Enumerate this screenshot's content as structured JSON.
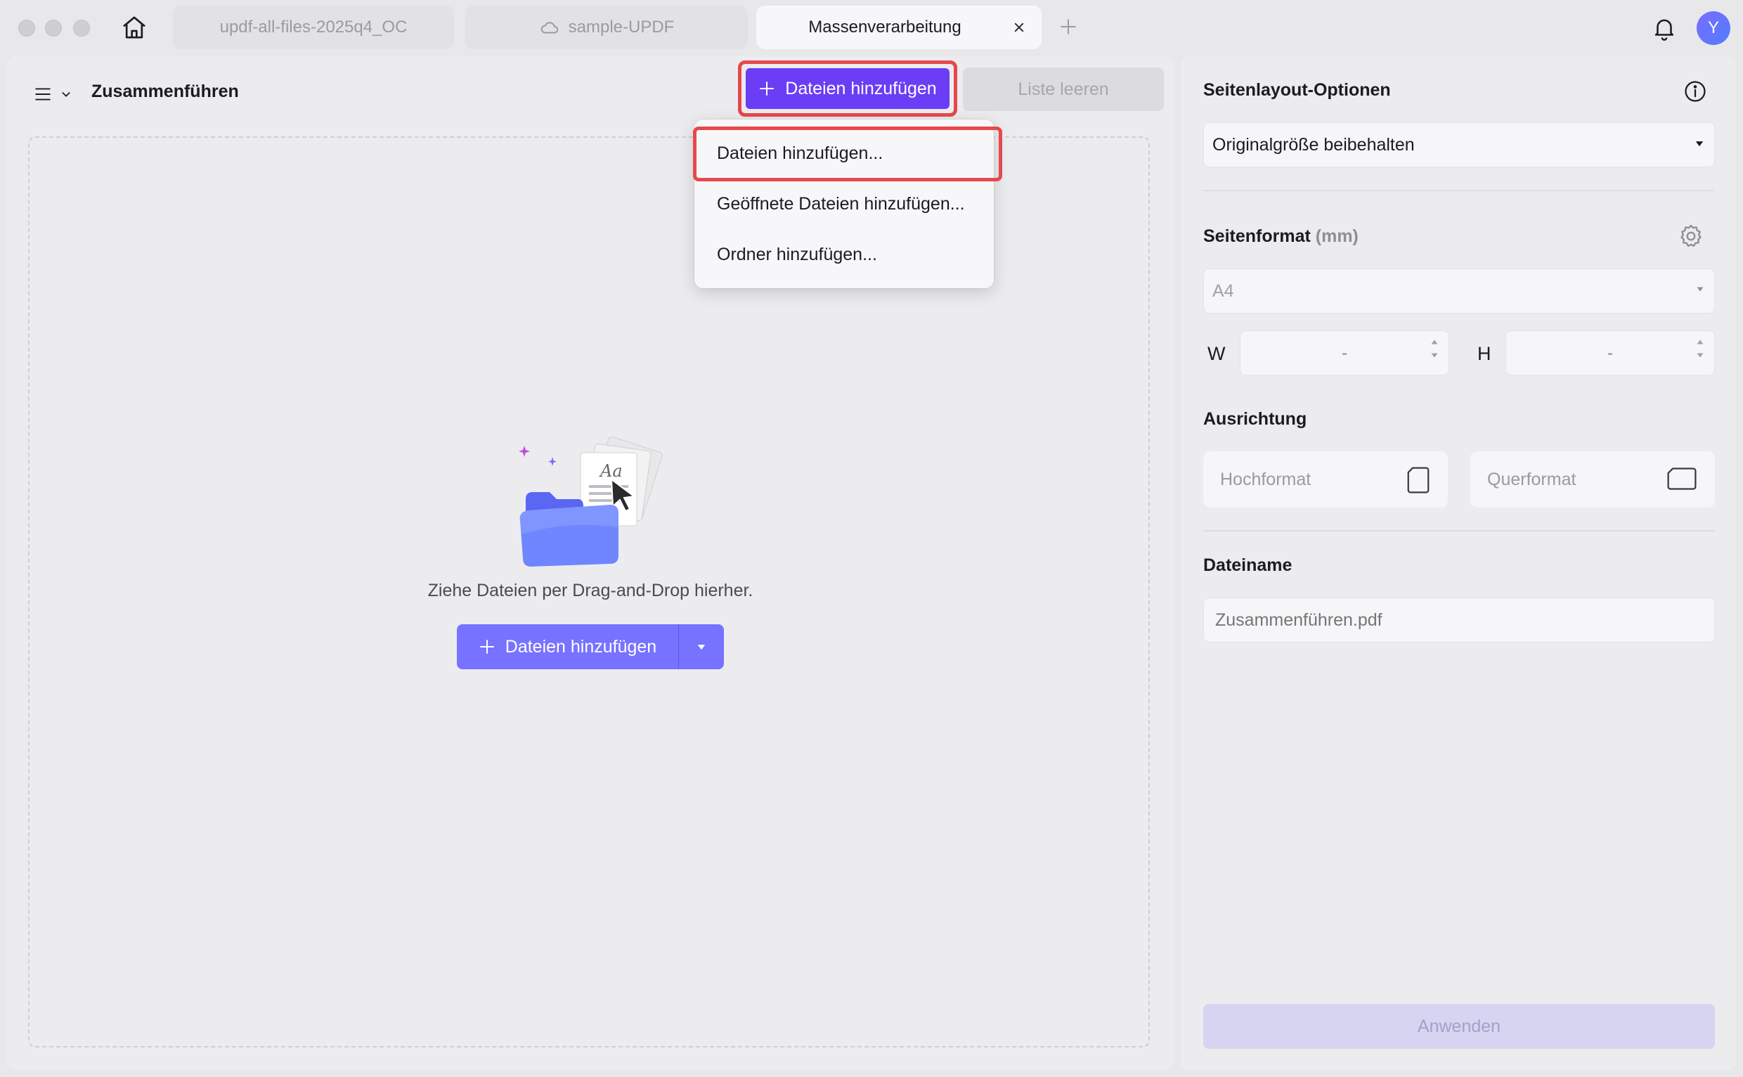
{
  "tabs": [
    {
      "label": "updf-all-files-2025q4_OC",
      "active": false
    },
    {
      "label": "sample-UPDF",
      "active": false,
      "icon": "cloud-icon"
    },
    {
      "label": "Massenverarbeitung",
      "active": true
    }
  ],
  "user": {
    "avatar_initial": "Y"
  },
  "left": {
    "title": "Zusammenführen",
    "add_files_label": "Dateien hinzufügen",
    "clear_list_label": "Liste leeren",
    "drop_text": "Ziehe Dateien per Drag-and-Drop hierher.",
    "center_add_label": "Dateien hinzufügen",
    "illustration_text": "Aa"
  },
  "dropdown": {
    "items": [
      {
        "label": "Dateien hinzufügen..."
      },
      {
        "label": "Geöffnete Dateien hinzufügen..."
      },
      {
        "label": "Ordner hinzufügen..."
      }
    ]
  },
  "right": {
    "layout_heading": "Seitenlayout-Optionen",
    "layout_value": "Originalgröße beibehalten",
    "format_heading": "Seitenformat",
    "format_unit": "(mm)",
    "format_value": "A4",
    "width_label": "W",
    "width_value": "-",
    "height_label": "H",
    "height_value": "-",
    "orientation_heading": "Ausrichtung",
    "portrait_label": "Hochformat",
    "landscape_label": "Querformat",
    "filename_heading": "Dateiname",
    "filename_placeholder": "Zusammenführen.pdf",
    "apply_label": "Anwenden"
  },
  "colors": {
    "accent": "#6b3df5",
    "button_secondary": "#7772ff",
    "highlight_border": "#e5484d"
  }
}
